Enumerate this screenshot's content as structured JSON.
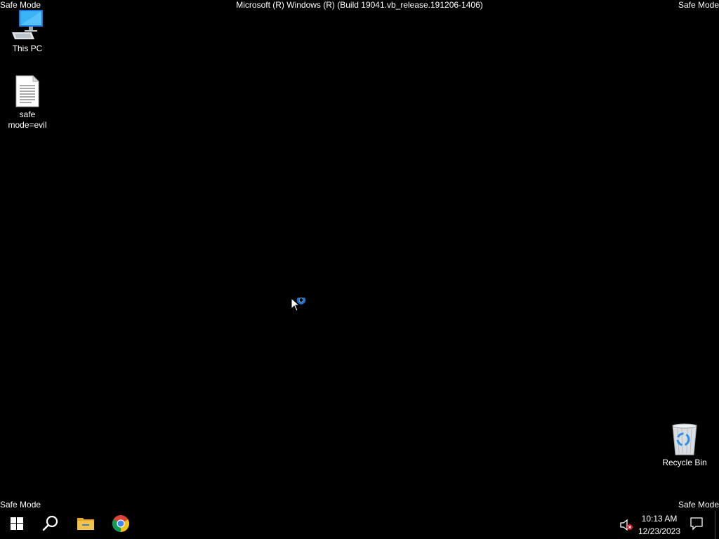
{
  "overlay": {
    "corner_label": "Safe Mode",
    "build": "Microsoft (R) Windows (R) (Build 19041.vb_release.191206-1406)"
  },
  "desktop": {
    "icons": [
      {
        "label": "This PC",
        "icon": "computer-icon"
      },
      {
        "label": "safe mode=evil",
        "icon": "text-file-icon"
      },
      {
        "label": "Recycle Bin",
        "icon": "recycle-bin-icon"
      }
    ]
  },
  "taskbar": {
    "pinned": [
      {
        "name": "start",
        "icon": "windows-logo-icon"
      },
      {
        "name": "search",
        "icon": "search-icon"
      },
      {
        "name": "file-explorer",
        "icon": "folder-icon"
      },
      {
        "name": "chrome",
        "icon": "chrome-icon"
      }
    ],
    "tray": {
      "time": "10:13 AM",
      "date": "12/23/2023",
      "volume_icon": "speaker-muted-icon",
      "notifications_icon": "action-center-icon"
    }
  },
  "colors": {
    "background": "#000000",
    "accent": "#2f8fe8",
    "folder": "#f2c24b"
  }
}
